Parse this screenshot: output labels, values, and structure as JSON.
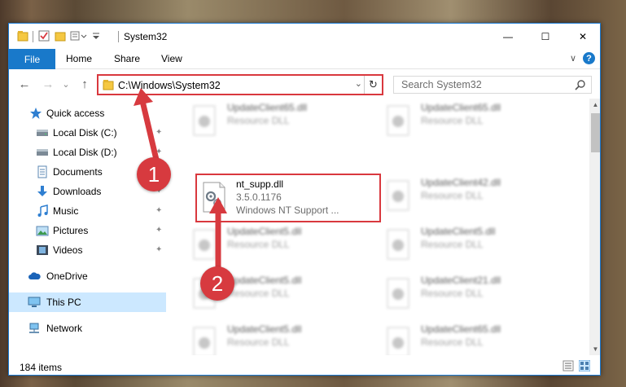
{
  "window": {
    "title": "System32",
    "accent": "#1979ca",
    "minimize": "—",
    "maximize": "☐",
    "close": "✕"
  },
  "ribbon": {
    "file": "File",
    "home": "Home",
    "share": "Share",
    "view": "View",
    "expand": "∨",
    "help": "?"
  },
  "nav": {
    "back": "←",
    "forward": "→",
    "recent": "⌄",
    "up": "↑",
    "address": "C:\\Windows\\System32",
    "address_dropdown": "⌄",
    "refresh": "↻",
    "search_placeholder": "Search System32"
  },
  "sidebar": {
    "items": [
      {
        "label": "Quick access",
        "icon": "star-icon"
      },
      {
        "label": "Local Disk (C:)",
        "icon": "drive-icon",
        "pinned": true
      },
      {
        "label": "Local Disk (D:)",
        "icon": "drive-icon",
        "pinned": true
      },
      {
        "label": "Documents",
        "icon": "documents-icon",
        "pinned": true
      },
      {
        "label": "Downloads",
        "icon": "downloads-icon",
        "pinned": true
      },
      {
        "label": "Music",
        "icon": "music-icon",
        "pinned": true
      },
      {
        "label": "Pictures",
        "icon": "pictures-icon",
        "pinned": true
      },
      {
        "label": "Videos",
        "icon": "videos-icon",
        "pinned": true
      },
      {
        "label": "OneDrive",
        "icon": "cloud-icon"
      },
      {
        "label": "This PC",
        "icon": "computer-icon",
        "selected": true
      },
      {
        "label": "Network",
        "icon": "network-icon"
      }
    ],
    "pin_glyph": "✦"
  },
  "files": {
    "highlight": {
      "name": "nt_supp.dll",
      "version": "3.5.0.1176",
      "description": "Windows NT Support ..."
    },
    "blurred": [
      {
        "name": "UpdateClient65.dll",
        "type": "Resource DLL"
      },
      {
        "name": "UpdateClient65.dll",
        "type": "Resource DLL"
      },
      {
        "name": "UpdateClient42.dll",
        "type": "Resource DLL"
      },
      {
        "name": "UpdateClient5.dll",
        "type": "Resource DLL"
      },
      {
        "name": "UpdateClient5.dll",
        "type": "Resource DLL"
      },
      {
        "name": "UpdateClient5.dll",
        "type": "Resource DLL"
      },
      {
        "name": "UpdateClient21.dll",
        "type": "Resource DLL"
      },
      {
        "name": "UpdateClient5.dll",
        "type": "Resource DLL"
      },
      {
        "name": "UpdateClient65.dll",
        "type": "Resource DLL"
      }
    ]
  },
  "status": {
    "count": "184 items"
  },
  "annotations": {
    "step1": "1",
    "step2": "2",
    "color": "#d73a3f"
  },
  "scroll": {
    "up": "▲",
    "down": "▼"
  }
}
